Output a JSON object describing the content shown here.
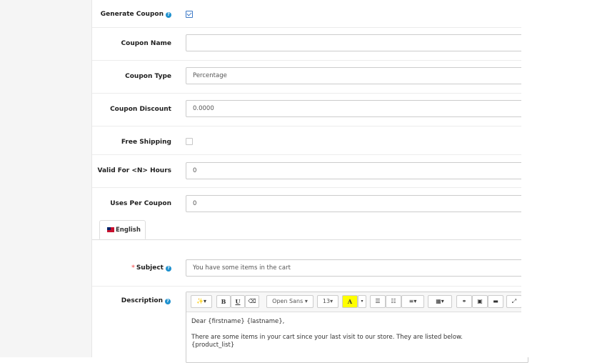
{
  "form": {
    "generate_coupon": {
      "label": "Generate Coupon",
      "checked": true
    },
    "coupon_name": {
      "label": "Coupon Name",
      "value": ""
    },
    "coupon_type": {
      "label": "Coupon Type",
      "value": "Percentage"
    },
    "coupon_discount": {
      "label": "Coupon Discount",
      "value": "0.0000"
    },
    "free_shipping": {
      "label": "Free Shipping",
      "checked": false
    },
    "valid_for": {
      "label": "Valid For <N> Hours",
      "value": "0"
    },
    "uses_per_coupon": {
      "label": "Uses Per Coupon",
      "value": "0"
    }
  },
  "tabs": [
    {
      "label": "English",
      "active": true
    }
  ],
  "subject": {
    "required": "*",
    "label": "Subject",
    "value": "You have some items in the cart"
  },
  "description": {
    "label": "Description",
    "toolbar": {
      "font_family": "Open Sans",
      "font_size": "13",
      "bold": "B",
      "underline": "U",
      "color": "A"
    },
    "body_lines": [
      "Dear {firstname} {lastname},",
      "",
      "There are some items in your cart since your last visit to our store. They are listed below.",
      "{product_list}"
    ]
  },
  "colors": {
    "help_icon": "#1e91cf",
    "required": "#f56b6b",
    "highlight": "#ffff00"
  }
}
